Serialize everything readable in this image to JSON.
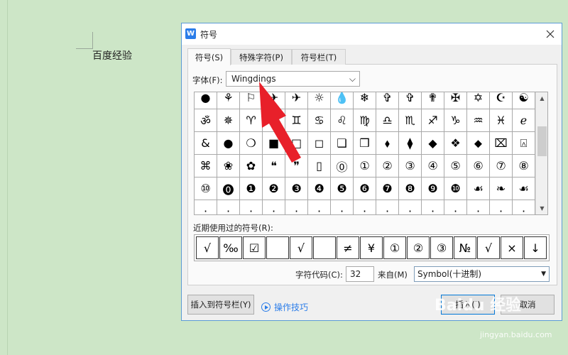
{
  "document": {
    "text": "百度经验"
  },
  "dialog": {
    "title": "符号",
    "app_icon": "W",
    "close_symbol": "✕",
    "tabs": [
      {
        "label": "符号(S)",
        "active": true
      },
      {
        "label": "特殊字符(P)",
        "active": false
      },
      {
        "label": "符号栏(T)",
        "active": false
      }
    ],
    "font_label": "字体(F):",
    "font_value": "Wingdings",
    "chevron": "⌵",
    "symbol_rows": [
      [
        "●",
        "⚘",
        "⚐",
        "✈",
        "✈",
        "☼",
        "💧",
        "❄",
        "✞",
        "✞",
        "✟",
        "✠",
        "✡",
        "☪",
        "☯"
      ],
      [
        "ॐ",
        "✵",
        "♈",
        "♉",
        "♊",
        "♋",
        "♌",
        "♍",
        "♎",
        "♏",
        "♐",
        "♑",
        "♒",
        "♓",
        "ℯ"
      ],
      [
        "&",
        "●",
        "❍",
        "■",
        "□",
        "◻",
        "❑",
        "❒",
        "⬧",
        "⧫",
        "◆",
        "❖",
        "⬥",
        "⌧",
        "⍓"
      ],
      [
        "⌘",
        "❀",
        "✿",
        "❝",
        "❞",
        "▯",
        "⓪",
        "①",
        "②",
        "③",
        "④",
        "⑤",
        "⑥",
        "⑦",
        "⑧"
      ],
      [
        "⑩",
        "⓿",
        "❶",
        "❷",
        "❸",
        "❹",
        "❺",
        "❻",
        "❼",
        "❽",
        "❾",
        "❿",
        "☙",
        "❧",
        "☙"
      ],
      [
        "·",
        "·",
        "·",
        "·",
        "·",
        "·",
        "·",
        "·",
        "·",
        "·",
        "·",
        "·",
        "·",
        "·",
        "·"
      ]
    ],
    "scroll_up": "▲",
    "scroll_down": "▼",
    "recent_label": "近期使用过的符号(R):",
    "recent_symbols": [
      "√",
      "‰",
      "☑",
      "",
      "√",
      "",
      "≠",
      "¥",
      "①",
      "②",
      "③",
      "№",
      "√",
      "×",
      "↓"
    ],
    "code_label": "字符代码(C):",
    "code_value": "32",
    "from_label": "来自(M)",
    "from_value": "Symbol(十进制)",
    "from_chevron": "▼",
    "insert_to_bar_button": "插入到符号栏(Y)",
    "howto_link": "操作技巧",
    "insert_button": "插入(I)",
    "cancel_button": "取消"
  },
  "watermark": {
    "brand": "Baidu 经验",
    "url": "jingyan.baidu.com"
  },
  "colors": {
    "page_bg": "#cde6c7",
    "dialog_border": "#5b9bd5",
    "arrow": "#e8202a",
    "link": "#2b7de9"
  }
}
